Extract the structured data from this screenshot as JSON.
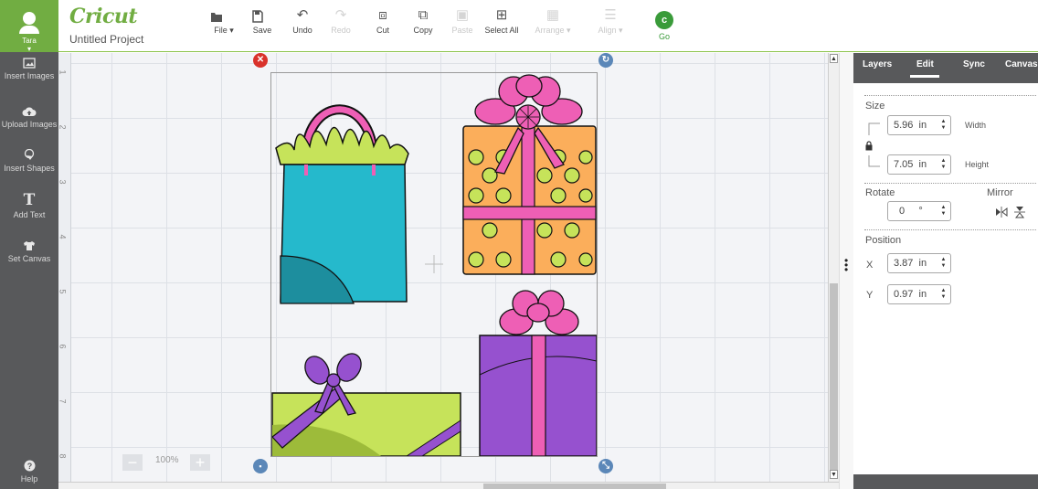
{
  "user": {
    "name": "Tara"
  },
  "sidebar": {
    "items": [
      {
        "label": "Insert Images",
        "icon": "image-icon"
      },
      {
        "label": "Upload Images",
        "icon": "cloud-upload-icon"
      },
      {
        "label": "Insert Shapes",
        "icon": "shapes-icon"
      },
      {
        "label": "Add Text",
        "icon": "text-icon"
      },
      {
        "label": "Set Canvas",
        "icon": "shirt-icon"
      }
    ],
    "help": "Help"
  },
  "header": {
    "logo": "Cricut",
    "project_name": "Untitled Project"
  },
  "toolbar": {
    "file": "File ▾",
    "save": "Save",
    "undo": "Undo",
    "redo": "Redo",
    "cut": "Cut",
    "copy": "Copy",
    "paste": "Paste",
    "select_all": "Select All",
    "arrange": "Arrange ▾",
    "align": "Align ▾",
    "go": "Go"
  },
  "canvas": {
    "ruler_marks": [
      "1",
      "2",
      "3",
      "4",
      "5",
      "6",
      "7",
      "8"
    ],
    "zoom": "100%"
  },
  "panel": {
    "tabs": [
      "Layers",
      "Edit",
      "Sync",
      "Canvas"
    ],
    "active_tab": "Edit",
    "size_label": "Size",
    "width_value": "5.96",
    "width_unit": "in",
    "width_label": "Width",
    "height_value": "7.05",
    "height_unit": "in",
    "height_label": "Height",
    "rotate_label": "Rotate",
    "rotate_value": "0",
    "rotate_unit": "°",
    "mirror_label": "Mirror",
    "position_label": "Position",
    "x_label": "X",
    "x_value": "3.87",
    "x_unit": "in",
    "y_label": "Y",
    "y_value": "0.97",
    "y_unit": "in"
  },
  "colors": {
    "brand_green": "#71ad42",
    "sidebar": "#58595b",
    "go": "#3a9b3a",
    "delete_handle": "#d9322b",
    "handle_blue": "#5b87b8"
  }
}
